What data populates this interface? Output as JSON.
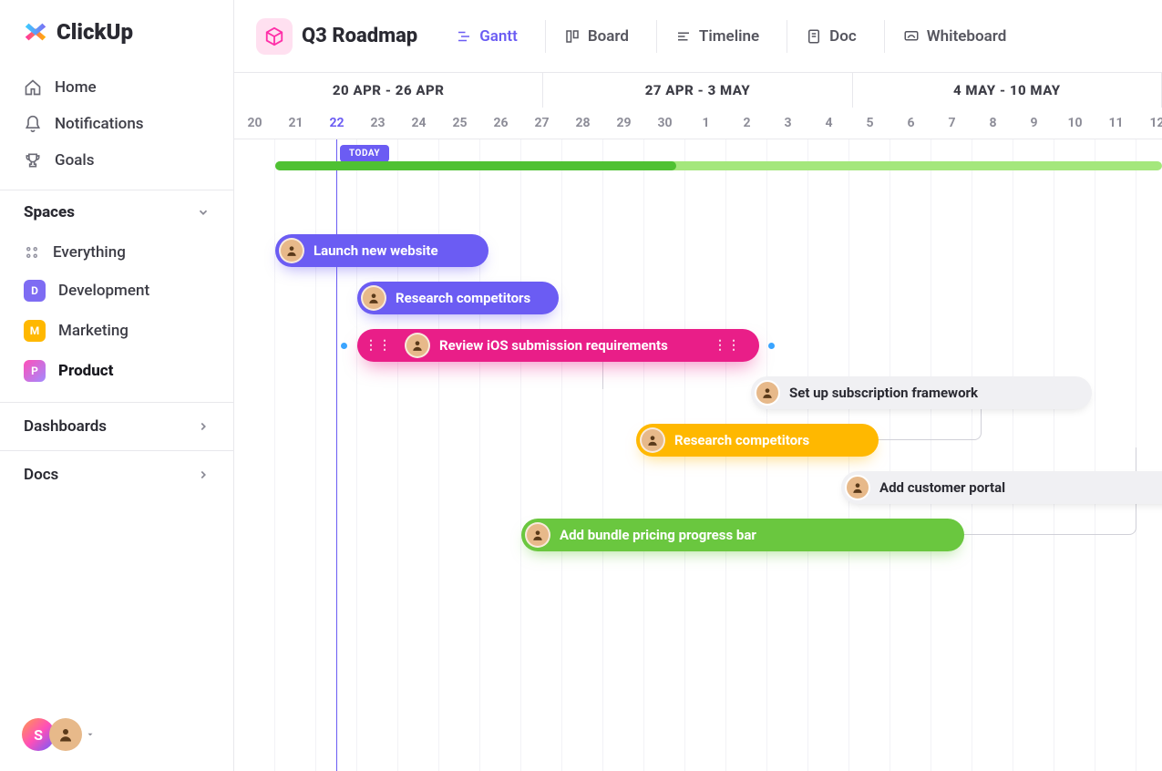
{
  "app": {
    "brand": "ClickUp"
  },
  "sidebar": {
    "nav": [
      {
        "label": "Home"
      },
      {
        "label": "Notifications"
      },
      {
        "label": "Goals"
      }
    ],
    "spaces_header": "Spaces",
    "everything_label": "Everything",
    "spaces": [
      {
        "label": "Development",
        "letter": "D"
      },
      {
        "label": "Marketing",
        "letter": "M"
      },
      {
        "label": "Product",
        "letter": "P",
        "active": true
      }
    ],
    "dashboards_label": "Dashboards",
    "docs_label": "Docs",
    "user_initial": "S"
  },
  "header": {
    "title": "Q3 Roadmap",
    "views": [
      {
        "label": "Gantt",
        "active": true
      },
      {
        "label": "Board"
      },
      {
        "label": "Timeline"
      },
      {
        "label": "Doc"
      },
      {
        "label": "Whiteboard"
      }
    ]
  },
  "timeline": {
    "weeks": [
      "20 APR - 26 APR",
      "27 APR - 3 MAY",
      "4 MAY - 10 MAY"
    ],
    "days": [
      "20",
      "21",
      "22",
      "23",
      "24",
      "25",
      "26",
      "27",
      "28",
      "29",
      "30",
      "1",
      "2",
      "3",
      "4",
      "5",
      "6",
      "7",
      "8",
      "9",
      "10",
      "11",
      "12"
    ],
    "today_index": 2,
    "today_label": "TODAY"
  },
  "tasks": [
    {
      "id": "t1",
      "label": "Launch new website",
      "color": "purple",
      "start": 1,
      "span": 5.2,
      "row": 0
    },
    {
      "id": "t2",
      "label": "Research competitors",
      "color": "purple",
      "start": 3,
      "span": 4.9,
      "row": 1
    },
    {
      "id": "t3",
      "label": "Review iOS submission requirements",
      "color": "pink",
      "start": 3,
      "span": 9.8,
      "row": 2,
      "handles": true,
      "leftdot": true,
      "rightdot": true
    },
    {
      "id": "t4",
      "label": "Set up subscription framework",
      "color": "white",
      "start": 12.6,
      "span": 8.3,
      "row": 3
    },
    {
      "id": "t5",
      "label": "Research competitors",
      "color": "yellow",
      "start": 9.8,
      "span": 5.9,
      "row": 4
    },
    {
      "id": "t6",
      "label": "Add customer portal",
      "color": "white",
      "start": 14.8,
      "span": 9,
      "row": 5
    },
    {
      "id": "t7",
      "label": "Add bundle pricing progress bar",
      "color": "green",
      "start": 7,
      "span": 10.8,
      "row": 6
    }
  ]
}
